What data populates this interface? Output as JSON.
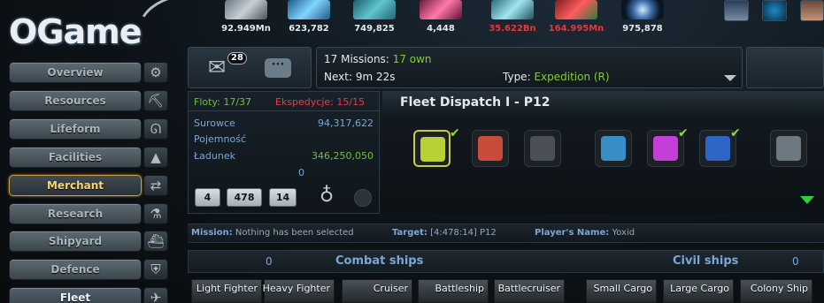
{
  "logo": {
    "text": "OGame"
  },
  "resources": [
    {
      "name": "metal",
      "value": "92.949Mn",
      "color": "#dde4ea"
    },
    {
      "name": "crystal",
      "value": "623,782",
      "color": "#dde4ea"
    },
    {
      "name": "deuterium",
      "value": "749,825",
      "color": "#dde4ea"
    },
    {
      "name": "energy",
      "value": "4,448",
      "color": "#dde4ea"
    },
    {
      "name": "population",
      "value": "35.622Bn",
      "color": "#e03a3a"
    },
    {
      "name": "food",
      "value": "164.995Mn",
      "color": "#e03a3a"
    },
    {
      "name": "dark-matter",
      "value": "975,878",
      "color": "#dde4ea"
    }
  ],
  "menu": [
    {
      "label": "Overview",
      "icon": "gear-icon",
      "state": "normal"
    },
    {
      "label": "Resources",
      "icon": "mine-icon",
      "state": "normal"
    },
    {
      "label": "Lifeform",
      "icon": "dna-icon",
      "state": "normal"
    },
    {
      "label": "Facilities",
      "icon": "building-icon",
      "state": "normal"
    },
    {
      "label": "Merchant",
      "icon": "swap-icon",
      "state": "active"
    },
    {
      "label": "Research",
      "icon": "flask-icon",
      "state": "normal"
    },
    {
      "label": "Shipyard",
      "icon": "ship-icon",
      "state": "normal"
    },
    {
      "label": "Defence",
      "icon": "shield-icon",
      "state": "normal"
    },
    {
      "label": "Fleet",
      "icon": "fleet-icon",
      "state": "selected"
    }
  ],
  "messages": {
    "count": "28"
  },
  "events": {
    "missions_label": "17 Missions:",
    "missions_own": "17 own",
    "next": "Next: 9m 22s",
    "type_label": "Type:",
    "type_value": "Expedition (R)"
  },
  "fleet_info": {
    "floty": "Floty: 17/37",
    "ekspedycje": "Ekspedycje: 15/15",
    "surowce_label": "Surowce",
    "surowce_value": "94,317,622",
    "pojemnosc_label": "Pojemność",
    "ladunek_label": "Ładunek",
    "ladunek_value": "346,250,050",
    "extra_value": "0",
    "coords": [
      "4",
      "478",
      "14"
    ]
  },
  "dispatch": {
    "title": "Fleet Dispatch I - P12",
    "missions": [
      {
        "name": "expedition-mission",
        "color": "#b8d236",
        "checked": true,
        "selected": true
      },
      {
        "name": "attack-mission",
        "color": "#c94b3c",
        "checked": false,
        "selected": false
      },
      {
        "name": "transport-mission",
        "color": "#4a5055",
        "checked": false,
        "selected": false
      },
      {
        "name": "colonize-mission",
        "color": "#3a8ec8",
        "checked": false,
        "selected": false
      },
      {
        "name": "acs-attack-mission",
        "color": "#c43ed8",
        "checked": true,
        "selected": false
      },
      {
        "name": "deploy-mission",
        "color": "#2e66c6",
        "checked": true,
        "selected": false
      },
      {
        "name": "recycle-mission",
        "color": "#6d7880",
        "checked": false,
        "selected": false
      }
    ]
  },
  "mission_bar": {
    "mission_label": "Mission:",
    "mission_value": "Nothing has been selected",
    "target_label": "Target:",
    "target_value": "[4:478:14] P12",
    "player_label": "Player's Name:",
    "player_value": "Yoxid"
  },
  "ship_header": {
    "combat_count": "0",
    "combat_label": "Combat ships",
    "civil_label": "Civil ships",
    "civil_count": "0"
  },
  "ships": [
    "Light Fighter",
    "Heavy Fighter",
    "Cruiser",
    "Battleship",
    "Battlecruiser",
    "Small Cargo",
    "Large Cargo",
    "Colony Ship"
  ]
}
